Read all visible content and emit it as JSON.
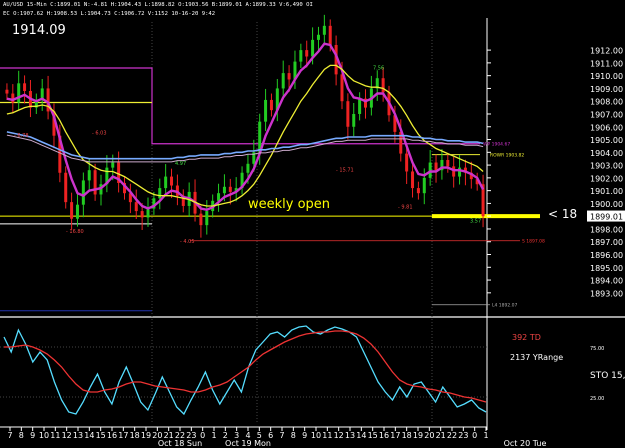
{
  "header": {
    "symbol_line": "AU/USD  15-Min  C:1899.01  N:-4.81  H:1904.43  L:1898.82  O:1903.56  B:1899.01  A:1899.33  V:6,490  OI",
    "indicator_line": "EC  O:1907.62  H:1908.53  L:1904.73  C:1906.72  V:1152  10-16-20  9:42",
    "big_price": "1914.09"
  },
  "colors": {
    "background": "#000000",
    "candle_up": "#22cc22",
    "candle_down": "#ee2222",
    "ma_fast": "#cc33cc",
    "ma_slow": "#eeee33",
    "ma_long": "#77aaff",
    "vwap": "#ccaacc",
    "grid": "#444444",
    "weekly_open_line": "#ffff00",
    "price_tag": "#ffffff",
    "stoch_fast": "#55ddff",
    "stoch_slow": "#ee3333"
  },
  "chart_data": [
    {
      "type": "line",
      "panel": "price",
      "title": "",
      "ylim": [
        1891.5,
        1914.2
      ],
      "y_ticks": [
        "1912.00",
        "1911.00",
        "1910.00",
        "1909.00",
        "1908.00",
        "1907.00",
        "1906.00",
        "1905.00",
        "1904.00",
        "1903.00",
        "1902.00",
        "1901.00",
        "1900.00",
        "1899.01",
        "1898.00",
        "1897.00",
        "1896.00",
        "1895.00",
        "1894.00",
        "1893.00"
      ],
      "x_ticks": [
        "7",
        "8",
        "9",
        "10",
        "11",
        "12",
        "13",
        "14",
        "15",
        "16",
        "17",
        "18",
        "19",
        "20",
        "21",
        "22",
        "23",
        "0",
        "1",
        "2",
        "3",
        "4",
        "5",
        "6",
        "7",
        "8",
        "9",
        "10",
        "11",
        "12",
        "13",
        "14",
        "15",
        "16",
        "17",
        "18",
        "19",
        "20",
        "21",
        "22",
        "23",
        "0",
        "1"
      ],
      "day_labels": [
        "Oct 18 Sun",
        "Oct 19 Mon",
        "Oct 20 Tue"
      ],
      "last_price": "1899.01",
      "arrow_label": "< 18",
      "series": [
        {
          "name": "close",
          "values": [
            1908.6,
            1907.9,
            1909.4,
            1908.8,
            1907.5,
            1908.1,
            1909.0,
            1907.2,
            1905.3,
            1902.4,
            1900.1,
            1898.8,
            1899.9,
            1901.8,
            1902.6,
            1900.7,
            1901.5,
            1902.8,
            1903.2,
            1901.6,
            1900.8,
            1900.1,
            1899.4,
            1898.9,
            1899.6,
            1900.4,
            1901.2,
            1902.1,
            1901.4,
            1900.6,
            1899.8,
            1900.9,
            1899.2,
            1898.3,
            1899.4,
            1900.2,
            1900.8,
            1901.3,
            1900.9,
            1901.2,
            1902.4,
            1903.1,
            1904.0,
            1906.4,
            1908.1,
            1907.3,
            1909.0,
            1910.2,
            1909.7,
            1911.1,
            1912.0,
            1911.5,
            1912.8,
            1913.2,
            1913.9,
            1912.4,
            1910.1,
            1908.0,
            1906.0,
            1907.0,
            1908.2,
            1907.5,
            1909.0,
            1909.8,
            1908.7,
            1906.9,
            1905.6,
            1903.9,
            1902.5,
            1901.2,
            1900.8,
            1902.0,
            1903.2,
            1902.6,
            1903.4,
            1902.9,
            1902.1,
            1902.8,
            1902.4,
            1901.9,
            1901.5,
            1899.0
          ]
        },
        {
          "name": "ma_fast",
          "values": [
            1908.2,
            1908.1,
            1908.3,
            1908.5,
            1908.2,
            1908.0,
            1908.2,
            1907.9,
            1906.8,
            1905.1,
            1903.4,
            1901.9,
            1900.8,
            1900.6,
            1901.0,
            1901.1,
            1901.2,
            1901.6,
            1902.1,
            1901.9,
            1901.4,
            1900.9,
            1900.3,
            1899.8,
            1899.6,
            1899.8,
            1900.2,
            1900.7,
            1901.0,
            1900.9,
            1900.5,
            1900.4,
            1900.1,
            1899.6,
            1899.5,
            1899.7,
            1900.1,
            1900.5,
            1900.7,
            1900.9,
            1901.3,
            1901.9,
            1902.7,
            1903.9,
            1905.3,
            1906.3,
            1907.3,
            1908.3,
            1908.9,
            1909.7,
            1910.4,
            1910.8,
            1911.4,
            1911.9,
            1912.5,
            1912.4,
            1911.6,
            1910.4,
            1909.0,
            1908.3,
            1908.2,
            1908.0,
            1908.2,
            1908.6,
            1908.6,
            1907.9,
            1907.0,
            1905.8,
            1904.5,
            1903.2,
            1902.3,
            1902.2,
            1902.5,
            1902.5,
            1902.8,
            1902.8,
            1902.6,
            1902.6,
            1902.5,
            1902.3,
            1902.0,
            1901.1
          ]
        },
        {
          "name": "ma_slow",
          "values": [
            1907.0,
            1907.1,
            1907.3,
            1907.5,
            1907.6,
            1907.6,
            1907.7,
            1907.6,
            1907.2,
            1906.5,
            1905.6,
            1904.8,
            1904.0,
            1903.4,
            1903.1,
            1902.8,
            1902.6,
            1902.5,
            1902.5,
            1902.3,
            1902.1,
            1901.8,
            1901.5,
            1901.2,
            1900.9,
            1900.7,
            1900.6,
            1900.6,
            1900.6,
            1900.5,
            1900.4,
            1900.3,
            1900.1,
            1899.9,
            1899.8,
            1899.8,
            1899.9,
            1900.0,
            1900.1,
            1900.3,
            1900.6,
            1901.0,
            1901.5,
            1902.2,
            1903.0,
            1903.8,
            1904.7,
            1905.6,
            1906.4,
            1907.2,
            1908.0,
            1908.6,
            1909.3,
            1909.9,
            1910.5,
            1910.8,
            1910.8,
            1910.5,
            1910.0,
            1909.6,
            1909.4,
            1909.2,
            1909.1,
            1909.1,
            1909.0,
            1908.7,
            1908.2,
            1907.6,
            1906.9,
            1906.1,
            1905.4,
            1904.9,
            1904.6,
            1904.3,
            1904.1,
            1903.9,
            1903.7,
            1903.5,
            1903.3,
            1903.1,
            1902.9,
            1902.5
          ]
        },
        {
          "name": "ma_long",
          "values": [
            1905.6,
            1905.5,
            1905.4,
            1905.3,
            1905.2,
            1905.0,
            1904.8,
            1904.6,
            1904.4,
            1904.2,
            1904.0,
            1903.8,
            1903.7,
            1903.6,
            1903.5,
            1903.5,
            1903.5,
            1903.5,
            1903.5,
            1903.5,
            1903.5,
            1903.5,
            1903.5,
            1903.5,
            1903.5,
            1903.5,
            1903.5,
            1903.5,
            1903.5,
            1903.6,
            1903.6,
            1903.7,
            1903.7,
            1903.8,
            1903.8,
            1903.8,
            1903.8,
            1903.9,
            1903.9,
            1904.0,
            1904.0,
            1904.1,
            1904.1,
            1904.2,
            1904.2,
            1904.3,
            1904.3,
            1904.4,
            1904.4,
            1904.5,
            1904.6,
            1904.6,
            1904.7,
            1904.8,
            1904.9,
            1905.0,
            1905.1,
            1905.1,
            1905.2,
            1905.2,
            1905.2,
            1905.2,
            1905.3,
            1905.3,
            1905.3,
            1905.3,
            1905.3,
            1905.3,
            1905.3,
            1905.2,
            1905.2,
            1905.1,
            1905.1,
            1905.0,
            1905.0,
            1904.9,
            1904.9,
            1904.9,
            1904.8,
            1904.8,
            1904.8,
            1904.7
          ]
        }
      ],
      "levels": [
        {
          "label": "weekly open",
          "value": 1899.0,
          "color": "#ffff00"
        },
        {
          "label": "WP 1904.67",
          "value": 1904.67,
          "color": "#cc33cc"
        },
        {
          "label": "ROWR 1903.82",
          "value": 1903.82,
          "color": "#eeee33"
        },
        {
          "label": "S 1897.08",
          "value": 1897.08,
          "color": "#ee3333"
        },
        {
          "label": "L4 1892.07",
          "value": 1892.07,
          "color": "#aaaaaa"
        }
      ],
      "annotations": [
        "- 6.78",
        "- 16.80",
        "4.97",
        "- 6.03",
        "- 4.05",
        "- 15.71",
        "7.56",
        "- 9.81",
        "3.57"
      ]
    },
    {
      "type": "line",
      "panel": "stochastic",
      "title": "STO 15,",
      "ylim": [
        0,
        100
      ],
      "y_ticks": [
        "25.00",
        "75.00"
      ],
      "series": [
        {
          "name": "fast",
          "values": [
            85,
            70,
            92,
            78,
            60,
            70,
            62,
            40,
            22,
            10,
            8,
            20,
            35,
            48,
            30,
            18,
            40,
            55,
            38,
            20,
            12,
            28,
            45,
            30,
            15,
            8,
            22,
            35,
            50,
            32,
            18,
            30,
            42,
            30,
            55,
            72,
            80,
            88,
            90,
            85,
            92,
            95,
            96,
            90,
            88,
            92,
            95,
            93,
            90,
            85,
            70,
            55,
            40,
            30,
            22,
            35,
            25,
            38,
            40,
            30,
            20,
            35,
            25,
            15,
            18,
            22,
            14,
            10
          ]
        },
        {
          "name": "slow",
          "values": [
            75,
            75,
            76,
            77,
            75,
            72,
            68,
            62,
            55,
            46,
            38,
            32,
            30,
            30,
            32,
            33,
            35,
            38,
            40,
            40,
            38,
            36,
            35,
            34,
            33,
            32,
            30,
            30,
            32,
            35,
            37,
            40,
            45,
            50,
            55,
            62,
            68,
            72,
            76,
            80,
            83,
            86,
            88,
            89,
            90,
            90,
            91,
            91,
            90,
            88,
            84,
            78,
            70,
            60,
            50,
            42,
            38,
            36,
            35,
            33,
            32,
            30,
            29,
            27,
            25,
            24,
            22,
            20
          ]
        }
      ],
      "labels": {
        "td": "392 TD",
        "range": "2137 YRange"
      }
    }
  ]
}
